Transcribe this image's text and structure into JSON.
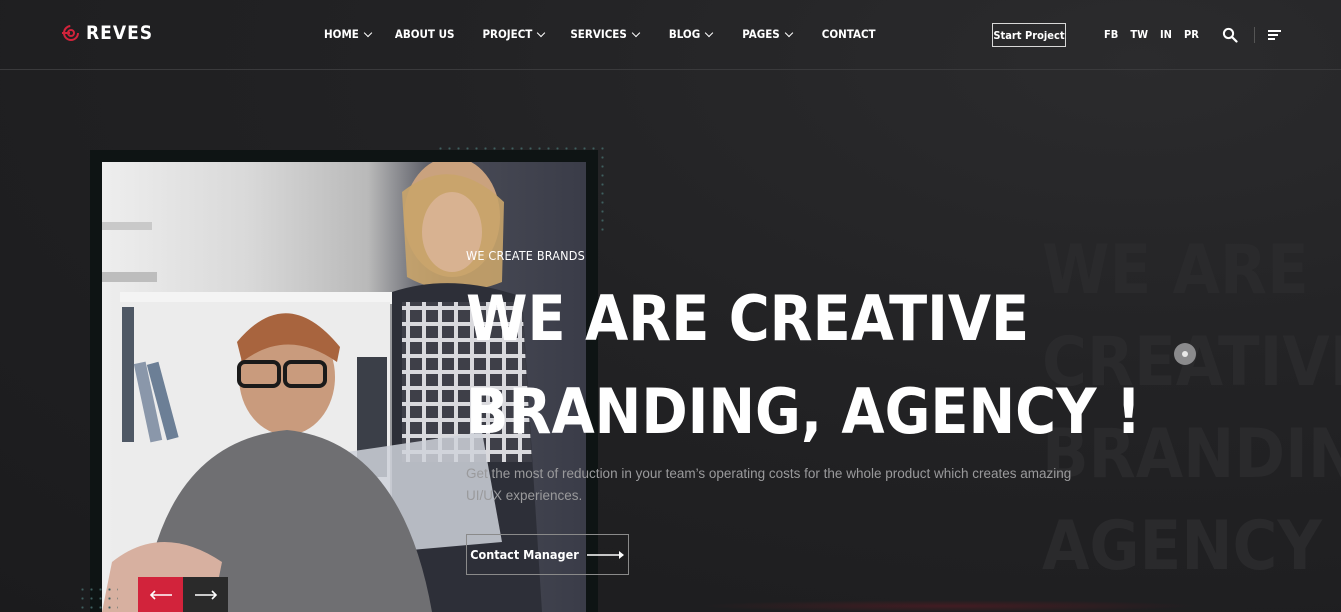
{
  "brand": {
    "name": "REVES",
    "accent": "#d2233b"
  },
  "nav": {
    "items": [
      {
        "label": "HOME",
        "dropdown": true
      },
      {
        "label": "ABOUT US",
        "dropdown": false
      },
      {
        "label": "PROJECT",
        "dropdown": true
      },
      {
        "label": "SERVICES",
        "dropdown": true
      },
      {
        "label": "BLOG",
        "dropdown": true
      },
      {
        "label": "PAGES",
        "dropdown": true
      },
      {
        "label": "CONTACT",
        "dropdown": false
      }
    ],
    "start_button": "Start Project",
    "socials": [
      "FB",
      "TW",
      "IN",
      "PR"
    ],
    "icons": {
      "search": "search-icon",
      "menu": "menu-icon"
    }
  },
  "hero": {
    "eyebrow": "WE CREATE BRANDS",
    "title_line1": "WE ARE CREATIVE",
    "title_line2": "BRANDING, AGENCY !",
    "description": "Get the most of reduction in your team’s operating costs for the whole product which creates amazing UI/UX experiences.",
    "cta_label": "Contact Manager",
    "background_text": [
      "WE ARE",
      "CREATIVE",
      "BRANDING,",
      "AGENCY !"
    ],
    "slider": {
      "prev_icon": "arrow-left-icon",
      "next_icon": "arrow-right-icon"
    }
  }
}
